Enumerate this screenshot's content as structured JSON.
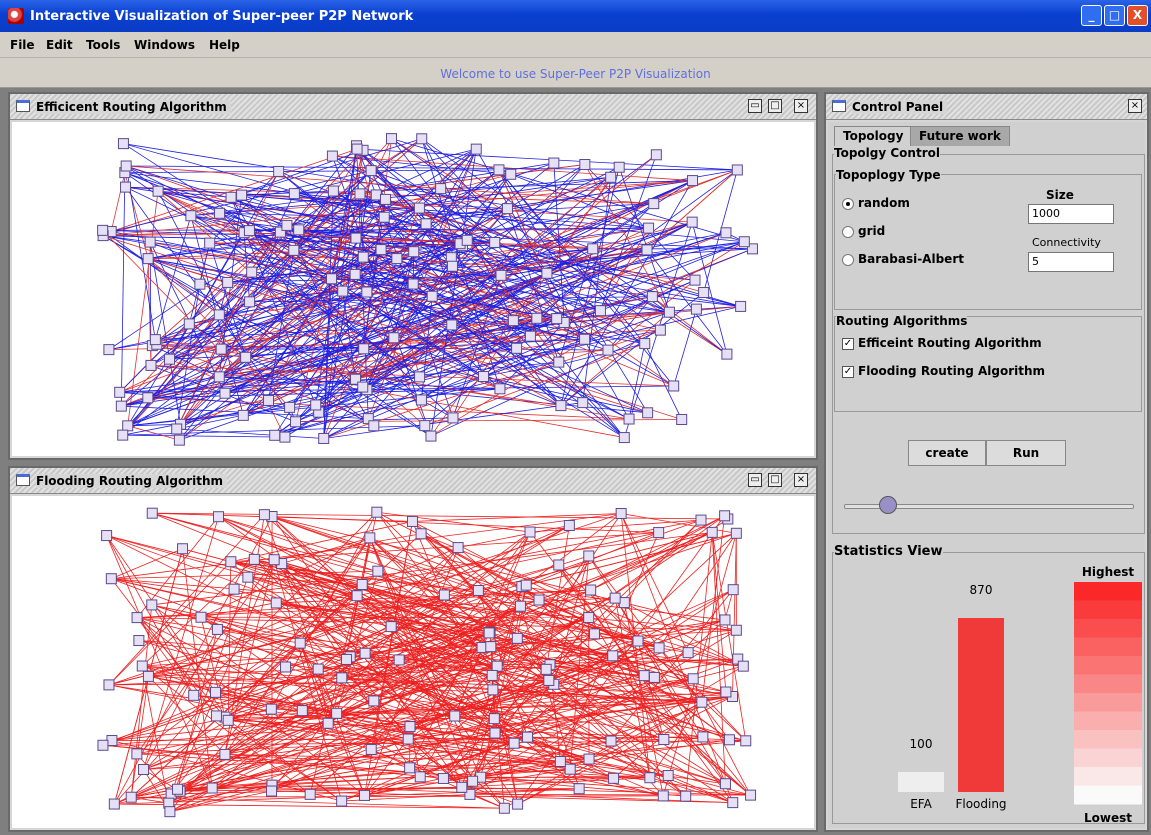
{
  "window": {
    "title": "Interactive Visualization of Super-peer P2P Network"
  },
  "menu": [
    "File",
    "Edit",
    "Tools",
    "Windows",
    "Help"
  ],
  "welcome": "Welcome to use Super-Peer P2P Visualization",
  "panels": {
    "efficient_title": "Efficicent Routing  Algorithm",
    "flooding_title": "Flooding Routing Algorithm",
    "control_title": "Control Panel"
  },
  "control": {
    "tabs": [
      "Topology",
      "Future work"
    ],
    "topology_control_label": "Topolgy Control",
    "topology_type_label": "Topoplogy Type",
    "options": [
      "random",
      "grid",
      "Barabasi-Albert"
    ],
    "selected_option": "random",
    "size_label": "Size",
    "size_value": "1000",
    "connectivity_label": "Connectivity",
    "connectivity_value": "5",
    "routing_label": "Routing Algorithms",
    "routing_options": [
      "Efficeint Routing Algorithm",
      "Flooding Routing Algorithm"
    ],
    "create_label": "create",
    "run_label": "Run",
    "slider_fraction": 0.15
  },
  "statistics": {
    "title": "Statistics View",
    "legend_high": "Highest",
    "legend_low": "Lowest",
    "bars": [
      {
        "label": "EFA",
        "value": 100,
        "color": "#eeeeee"
      },
      {
        "label": "Flooding",
        "value": 870,
        "color": "#f03a3a"
      }
    ]
  },
  "colors": {
    "efficient_edges": "#2020e0",
    "efficient_edges_alt": "#e03030",
    "flooding_edges": "#ee2020",
    "node_fill": "#e6e0f6",
    "node_border": "#5a4a8a"
  }
}
